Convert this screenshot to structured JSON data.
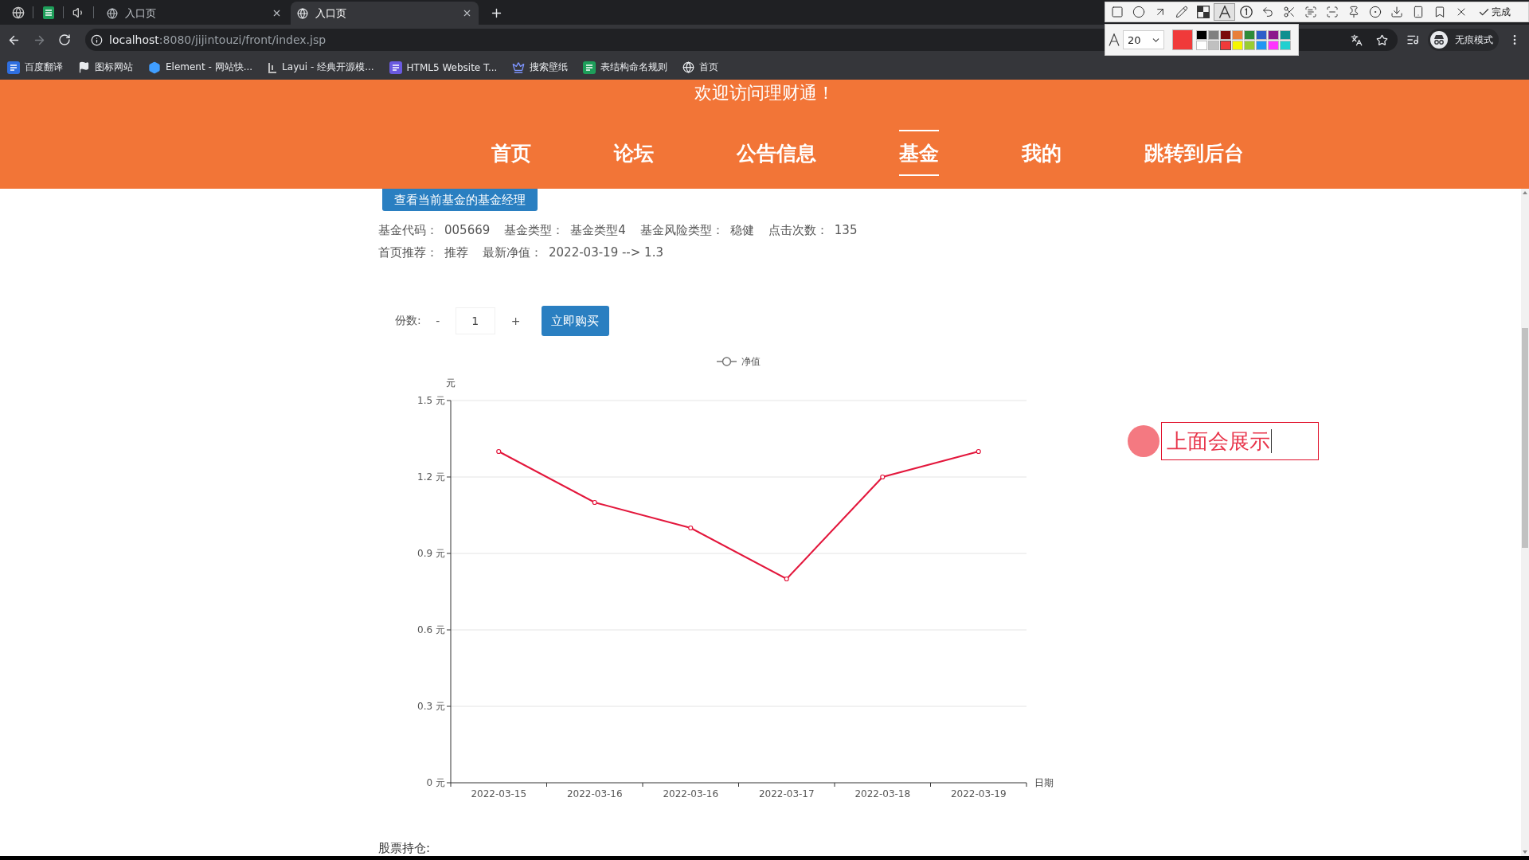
{
  "browser": {
    "tabs": [
      {
        "title": "入口页",
        "selected": false
      },
      {
        "title": "入口页",
        "selected": true
      }
    ],
    "address": {
      "host": "localhost",
      "path": ":8080/jijintouzi/front/index.jsp"
    },
    "profile_label": "无痕模式",
    "bookmarks": [
      {
        "label": "百度翻译",
        "kind": "tile",
        "color": "#2f6fe0"
      },
      {
        "label": "图标网站",
        "kind": "flag"
      },
      {
        "label": "Element - 网站快...",
        "kind": "hexagon"
      },
      {
        "label": "Layui - 经典开源模...",
        "kind": "mark"
      },
      {
        "label": "HTML5 Website T...",
        "kind": "tile",
        "color": "#6a5ae0"
      },
      {
        "label": "搜索壁纸",
        "kind": "crown"
      },
      {
        "label": "表结构命名规则",
        "kind": "tile",
        "color": "#1e9e5a"
      },
      {
        "label": "首页",
        "kind": "globe"
      }
    ]
  },
  "capture_toolbar": {
    "tools": [
      {
        "kind": "rectangle",
        "selected": false
      },
      {
        "kind": "ellipse",
        "selected": false
      },
      {
        "kind": "arrow",
        "selected": false
      },
      {
        "kind": "pencil",
        "selected": false
      },
      {
        "kind": "mosaic",
        "selected": false
      },
      {
        "kind": "text",
        "selected": true
      },
      {
        "kind": "number",
        "selected": false
      }
    ],
    "actions": [
      {
        "kind": "undo"
      },
      {
        "kind": "cut"
      },
      {
        "kind": "ocr"
      },
      {
        "kind": "scan"
      },
      {
        "kind": "pin"
      },
      {
        "kind": "record"
      },
      {
        "kind": "download"
      },
      {
        "kind": "phone"
      },
      {
        "kind": "bookmark"
      },
      {
        "kind": "close"
      }
    ],
    "done_label": "完成",
    "font_size": "20",
    "palette": [
      {
        "color": "#000000",
        "selected": false
      },
      {
        "color": "#808080",
        "selected": false
      },
      {
        "color": "#7a0a0a",
        "selected": false
      },
      {
        "color": "#e87f3a",
        "selected": false
      },
      {
        "color": "#2e8b3a",
        "selected": false
      },
      {
        "color": "#2d5ec9",
        "selected": false
      },
      {
        "color": "#8b1a8b",
        "selected": false
      },
      {
        "color": "#0f8f8f",
        "selected": false
      },
      {
        "color": "#ffffff",
        "selected": false
      },
      {
        "color": "#c0c0c0",
        "selected": false
      },
      {
        "color": "#f03a3a",
        "selected": true
      },
      {
        "color": "#f5f500",
        "selected": false
      },
      {
        "color": "#9acd32",
        "selected": false
      },
      {
        "color": "#2196f3",
        "selected": false
      },
      {
        "color": "#ff33ff",
        "selected": false
      },
      {
        "color": "#20d0d0",
        "selected": false
      }
    ]
  },
  "site_header": {
    "title": "欢迎访问理财通！",
    "nav": [
      {
        "label": "首页",
        "selected": false
      },
      {
        "label": "论坛",
        "selected": false
      },
      {
        "label": "公告信息",
        "selected": false
      },
      {
        "label": "基金",
        "selected": true
      },
      {
        "label": "我的",
        "selected": false
      },
      {
        "label": "跳转到后台",
        "selected": false
      }
    ]
  },
  "manager_button": "查看当前基金的基金经理",
  "fund_info": [
    {
      "fields": [
        {
          "label": "基金代码：",
          "value": "005669"
        },
        {
          "label": "基金类型：",
          "value": "基金类型4"
        },
        {
          "label": "基金风险类型：",
          "value": "稳健"
        },
        {
          "label": "点击次数：",
          "value": "135"
        }
      ]
    },
    {
      "fields": [
        {
          "label": "首页推荐：",
          "value": "推荐"
        },
        {
          "label": "最新净值：",
          "value": "2022-03-19 --> 1.3"
        }
      ]
    }
  ],
  "purchase": {
    "label": "份数:",
    "decrement": "-",
    "quantity": "1",
    "increment": "+",
    "buy_button": "立即购买"
  },
  "chart": {
    "chart_data": {
      "type": "line",
      "grid": true,
      "xlabel": "日期",
      "ylabel": "元",
      "categories": [
        "2022-03-15",
        "2022-03-16",
        "2022-03-16",
        "2022-03-17",
        "2022-03-18",
        "2022-03-19"
      ],
      "series": [
        {
          "name": "净值",
          "color": "#e3173c",
          "marker": "circle",
          "values": [
            1.3,
            1.1,
            1.0,
            0.8,
            1.2,
            1.3
          ]
        }
      ],
      "ylim": [
        0,
        1.5
      ],
      "yticks": [
        {
          "value": 0,
          "label": "0 元"
        },
        {
          "value": 0.3,
          "label": "0.3 元"
        },
        {
          "value": 0.6,
          "label": "0.6 元"
        },
        {
          "value": 0.9,
          "label": "0.9 元"
        },
        {
          "value": 1.2,
          "label": "1.2 元"
        },
        {
          "value": 1.5,
          "label": "1.5 元"
        }
      ]
    }
  },
  "holdings_heading": "股票持仓:",
  "screen_annotation": {
    "text": "上面会展示"
  }
}
